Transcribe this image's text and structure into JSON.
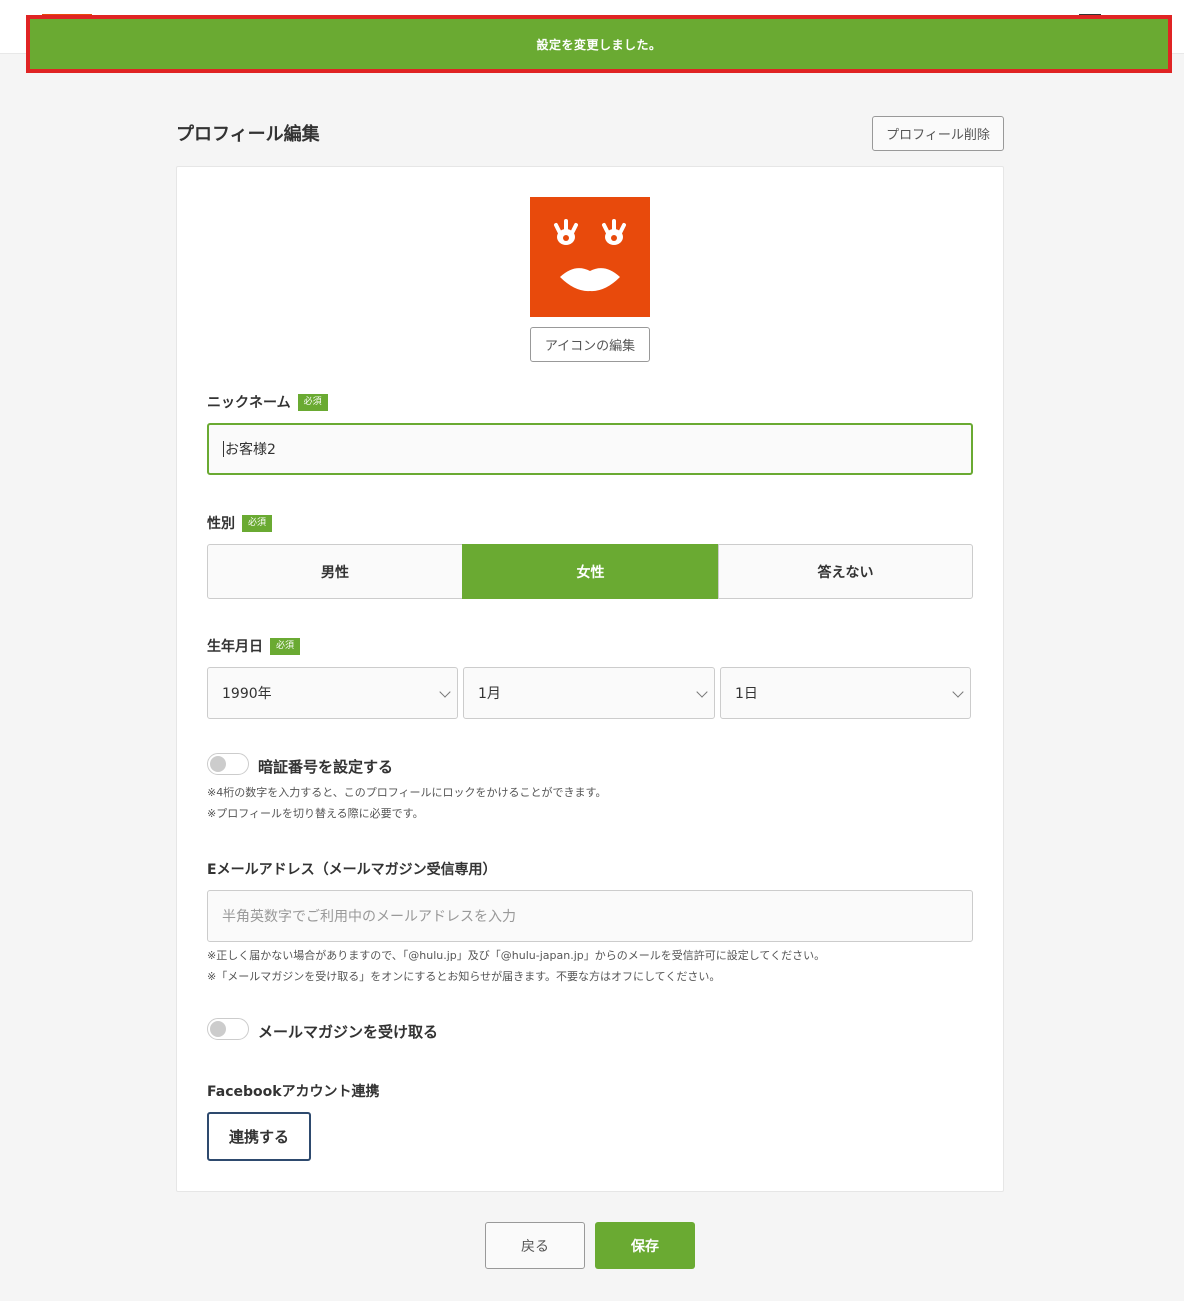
{
  "toast": {
    "message": "設定を変更しました。"
  },
  "page": {
    "title": "プロフィール編集",
    "delete_label": "プロフィール削除"
  },
  "avatar": {
    "icon": "face-icon",
    "color": "#e84a0c",
    "edit_label": "アイコンの編集"
  },
  "required_badge": "必須",
  "nickname": {
    "label": "ニックネーム",
    "value": "お客様2"
  },
  "gender": {
    "label": "性別",
    "options": [
      "男性",
      "女性",
      "答えない"
    ],
    "selected": "女性"
  },
  "birthdate": {
    "label": "生年月日",
    "year": "1990年",
    "month": "1月",
    "day": "1日"
  },
  "pin": {
    "label": "暗証番号を設定する",
    "enabled": false,
    "note1": "※4桁の数字を入力すると、このプロフィールにロックをかけることができます。",
    "note2": "※プロフィールを切り替える際に必要です。"
  },
  "email": {
    "label": "Eメールアドレス（メールマガジン受信専用）",
    "placeholder": "半角英数字でご利用中のメールアドレスを入力",
    "note1": "※正しく届かない場合がありますので、「@hulu.jp」及び「@hulu-japan.jp」からのメールを受信許可に設定してください。",
    "note2": "※「メールマガジンを受け取る」をオンにするとお知らせが届きます。不要な方はオフにしてください。"
  },
  "newsletter": {
    "label": "メールマガジンを受け取る",
    "enabled": false
  },
  "facebook": {
    "label": "Facebookアカウント連携",
    "button": "連携する"
  },
  "footer": {
    "back_label": "戻る",
    "save_label": "保存"
  },
  "colors": {
    "accent": "#6aaa32",
    "toast_border": "#e02424",
    "avatar": "#e84a0c"
  }
}
